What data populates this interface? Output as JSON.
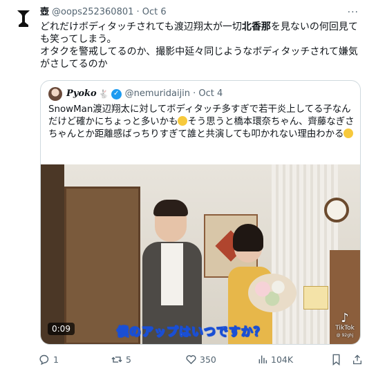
{
  "tweet": {
    "author_name": "壺",
    "meta": "@oops252360801 · Oct 6",
    "more": "···",
    "text_part1": "どれだけボディタッチされても渡辺翔太が一切",
    "text_bold": "北香那",
    "text_part2": "を見ないの何回見ても笑ってしまう。\nオタクを警戒してるのか、撮影中延々同じようなボディタッチされて嫌気がさしてるのか"
  },
  "quoted": {
    "author_name": "𝑷𝒚𝒐𝒌𝒐",
    "bunny": "🐇",
    "verified": "✓",
    "meta": "@nemuridaijin · Oct 4",
    "text_part1": "SnowMan渡辺翔太に対してボディタッチ多すぎで若干炎上してる子なんだけど確かにちょっと多いかも",
    "text_part2": "そう思うと橋本環奈ちゃん、齊藤なぎさちゃんとか距離感ばっちりすぎて誰と共演しても叩かれない理由わかる",
    "video": {
      "caption": "僕のアップはいつですか？",
      "duration": "0:09",
      "watermark": "TikTok",
      "handle": "@ 92ghj"
    }
  },
  "actions": {
    "replies": "1",
    "reposts": "5",
    "likes": "350",
    "views": "104K"
  }
}
